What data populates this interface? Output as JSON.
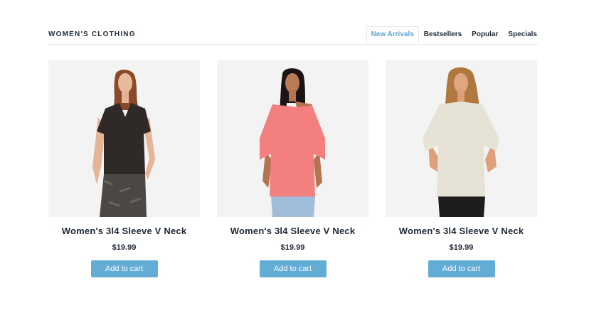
{
  "header": {
    "title": "WOMEN'S CLOTHING",
    "tabs": [
      {
        "label": "New Arrivals",
        "active": true
      },
      {
        "label": "Bestsellers",
        "active": false
      },
      {
        "label": "Popular",
        "active": false
      },
      {
        "label": "Specials",
        "active": false
      }
    ]
  },
  "products": [
    {
      "name": "Women's 3l4 Sleeve V Neck",
      "price": "$19.99",
      "button": "Add to cart",
      "shirt_color": "#2f2a27",
      "image_bg": "#f3f3f3"
    },
    {
      "name": "Women's 3l4 Sleeve V Neck",
      "price": "$19.99",
      "button": "Add to cart",
      "shirt_color": "#f47f7f",
      "image_bg": "#f3f3f3"
    },
    {
      "name": "Women's 3l4 Sleeve V Neck",
      "price": "$19.99",
      "button": "Add to cart",
      "shirt_color": "#e6e3d6",
      "image_bg": "#f3f3f3"
    }
  ],
  "colors": {
    "accent": "#62acd6",
    "active_tab": "#5ea3d0",
    "text": "#1f2a36"
  }
}
